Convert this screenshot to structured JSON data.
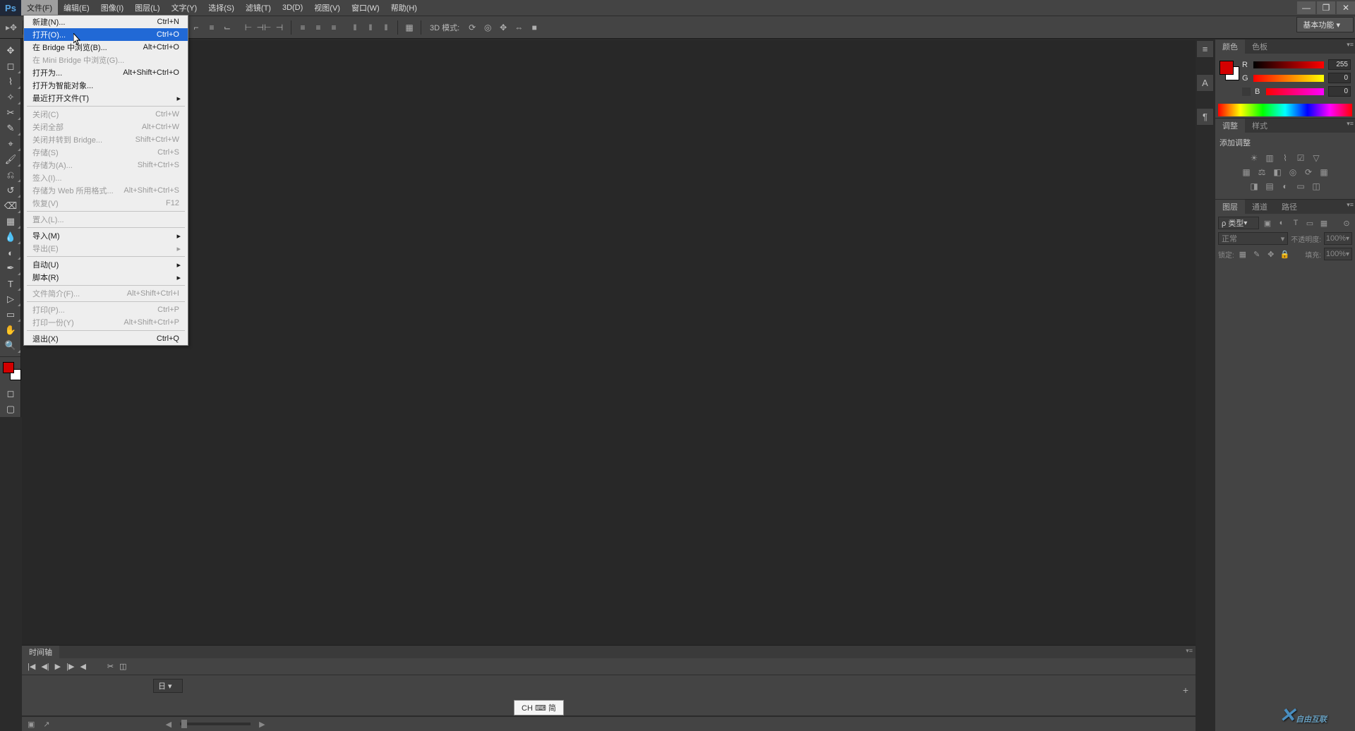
{
  "menubar": {
    "items": [
      "文件(F)",
      "编辑(E)",
      "图像(I)",
      "图层(L)",
      "文字(Y)",
      "选择(S)",
      "滤镜(T)",
      "3D(D)",
      "视图(V)",
      "窗口(W)",
      "帮助(H)"
    ]
  },
  "dropdown": {
    "groups": [
      [
        {
          "label": "新建(N)...",
          "short": "Ctrl+N"
        },
        {
          "label": "打开(O)...",
          "short": "Ctrl+O",
          "highlight": true
        },
        {
          "label": "在 Bridge 中浏览(B)...",
          "short": "Alt+Ctrl+O"
        },
        {
          "label": "在 Mini Bridge 中浏览(G)...",
          "disabled": true
        },
        {
          "label": "打开为...",
          "short": "Alt+Shift+Ctrl+O"
        },
        {
          "label": "打开为智能对象..."
        },
        {
          "label": "最近打开文件(T)",
          "arrow": true
        }
      ],
      [
        {
          "label": "关闭(C)",
          "short": "Ctrl+W",
          "disabled": true
        },
        {
          "label": "关闭全部",
          "short": "Alt+Ctrl+W",
          "disabled": true
        },
        {
          "label": "关闭并转到 Bridge...",
          "short": "Shift+Ctrl+W",
          "disabled": true
        },
        {
          "label": "存储(S)",
          "short": "Ctrl+S",
          "disabled": true
        },
        {
          "label": "存储为(A)...",
          "short": "Shift+Ctrl+S",
          "disabled": true
        },
        {
          "label": "签入(I)...",
          "disabled": true
        },
        {
          "label": "存储为 Web 所用格式...",
          "short": "Alt+Shift+Ctrl+S",
          "disabled": true
        },
        {
          "label": "恢复(V)",
          "short": "F12",
          "disabled": true
        }
      ],
      [
        {
          "label": "置入(L)...",
          "disabled": true
        }
      ],
      [
        {
          "label": "导入(M)",
          "arrow": true
        },
        {
          "label": "导出(E)",
          "arrow": true,
          "disabled": true
        }
      ],
      [
        {
          "label": "自动(U)",
          "arrow": true
        },
        {
          "label": "脚本(R)",
          "arrow": true
        }
      ],
      [
        {
          "label": "文件简介(F)...",
          "short": "Alt+Shift+Ctrl+I",
          "disabled": true
        }
      ],
      [
        {
          "label": "打印(P)...",
          "short": "Ctrl+P",
          "disabled": true
        },
        {
          "label": "打印一份(Y)",
          "short": "Alt+Shift+Ctrl+P",
          "disabled": true
        }
      ],
      [
        {
          "label": "退出(X)",
          "short": "Ctrl+Q"
        }
      ]
    ]
  },
  "optbar": {
    "mode_label": "3D 模式:"
  },
  "essentials": {
    "label": "基本功能"
  },
  "color_panel": {
    "tab1": "颜色",
    "tab2": "色板",
    "r_label": "R",
    "g_label": "G",
    "b_label": "B",
    "r": "255",
    "g": "0",
    "b": "0"
  },
  "adjust_panel": {
    "tab1": "调整",
    "tab2": "样式",
    "title": "添加调整"
  },
  "layers_panel": {
    "tab1": "图层",
    "tab2": "通道",
    "tab3": "路径",
    "kind": "ρ 类型",
    "blend": "正常",
    "opacity_label": "不透明度:",
    "opacity_val": "100%",
    "lock_label": "锁定:",
    "fill_label": "填充:",
    "fill_val": "100%"
  },
  "timeline": {
    "tab": "时间轴",
    "track_menu": "日"
  },
  "ime": {
    "text": "CH ⌨ 简"
  },
  "watermark": {
    "brand": "自由互联",
    "url": ""
  }
}
